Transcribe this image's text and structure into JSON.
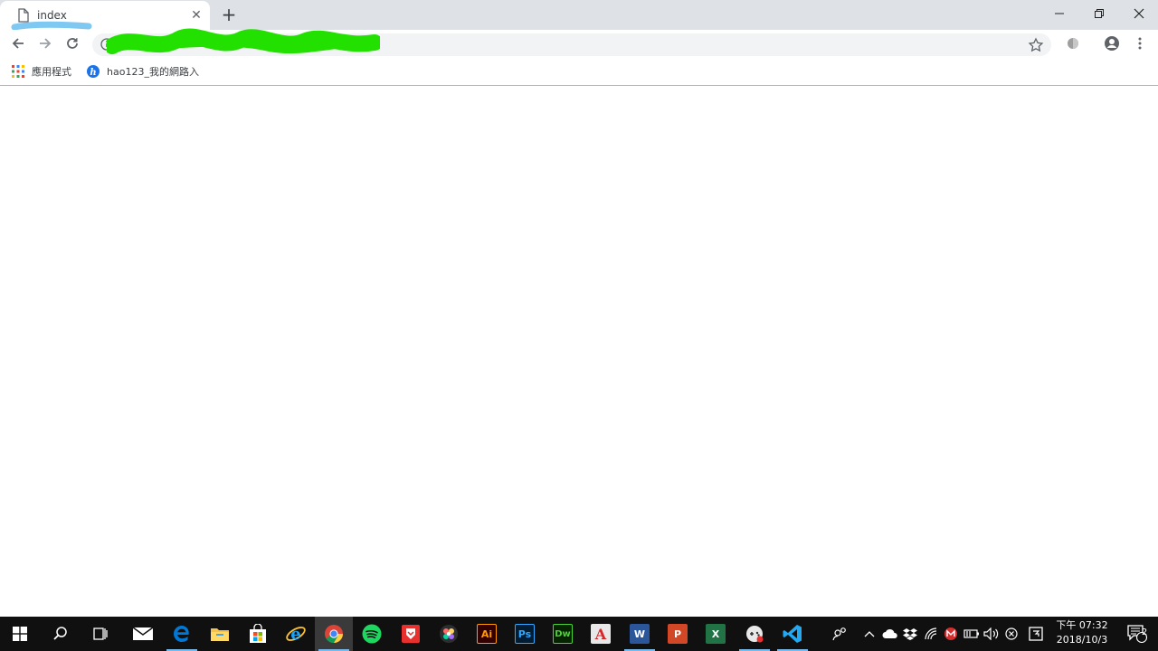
{
  "browser": {
    "tab": {
      "title": "index",
      "close": "✕"
    },
    "new_tab": "+"
  },
  "bookmarks": [
    {
      "label": "應用程式",
      "icon": "apps-grid-icon"
    },
    {
      "label": "hao123_我的網路入",
      "icon": "hao123-icon"
    }
  ],
  "taskbar": {
    "apps": [
      {
        "name": "mail",
        "icon": "mail-icon"
      },
      {
        "name": "edge",
        "icon": "edge-icon"
      },
      {
        "name": "file-explorer",
        "icon": "folder-icon"
      },
      {
        "name": "store",
        "icon": "store-icon"
      },
      {
        "name": "internet-explorer",
        "icon": "ie-icon"
      },
      {
        "name": "chrome",
        "icon": "chrome-icon"
      },
      {
        "name": "spotify",
        "icon": "spotify-icon"
      },
      {
        "name": "app-red",
        "icon": "red-app-icon"
      },
      {
        "name": "creative-cloud",
        "icon": "creative-cloud-icon"
      },
      {
        "name": "illustrator",
        "icon": "illustrator-icon",
        "text": "Ai"
      },
      {
        "name": "photoshop",
        "icon": "photoshop-icon",
        "text": "Ps"
      },
      {
        "name": "dreamweaver",
        "icon": "dreamweaver-icon",
        "text": "Dw"
      },
      {
        "name": "acrobat",
        "icon": "acrobat-icon",
        "text": "A"
      },
      {
        "name": "word",
        "icon": "word-icon",
        "text": "W"
      },
      {
        "name": "powerpoint",
        "icon": "powerpoint-icon",
        "text": "P"
      },
      {
        "name": "excel",
        "icon": "excel-icon",
        "text": "X"
      },
      {
        "name": "game-app",
        "icon": "game-app-icon"
      },
      {
        "name": "vscode",
        "icon": "vscode-icon"
      }
    ],
    "clock": {
      "time": "下午 07:32",
      "date": "2018/10/3"
    },
    "notification_count": "2"
  },
  "colors": {
    "tabstrip": "#dee1e6",
    "omnibox": "#f1f3f4",
    "taskbar": "#101010",
    "taskbar_active_underline": "#76b9ed",
    "url_scribble": "#22e000",
    "tab_scribble": "#7ec8f2"
  }
}
